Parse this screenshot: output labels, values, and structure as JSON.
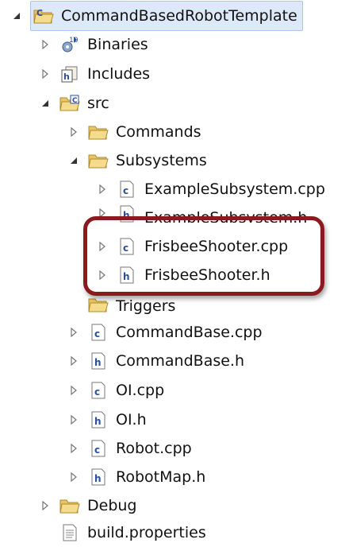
{
  "tree": {
    "root": "CommandBasedRobotTemplate",
    "binaries": "Binaries",
    "includes": "Includes",
    "src": "src",
    "commands": "Commands",
    "subsystems": "Subsystems",
    "example_cpp": "ExampleSubsystem.cpp",
    "example_h": "ExampleSubsystem.h",
    "frisbee_cpp": "FrisbeeShooter.cpp",
    "frisbee_h": "FrisbeeShooter.h",
    "triggers": "Triggers",
    "commandbase_cpp": "CommandBase.cpp",
    "commandbase_h": "CommandBase.h",
    "oi_cpp": "OI.cpp",
    "oi_h": "OI.h",
    "robot_cpp": "Robot.cpp",
    "robotmap_h": "RobotMap.h",
    "debug": "Debug",
    "build_properties": "build.properties"
  },
  "icons": {
    "c_letter": "c",
    "h_letter": "h"
  }
}
